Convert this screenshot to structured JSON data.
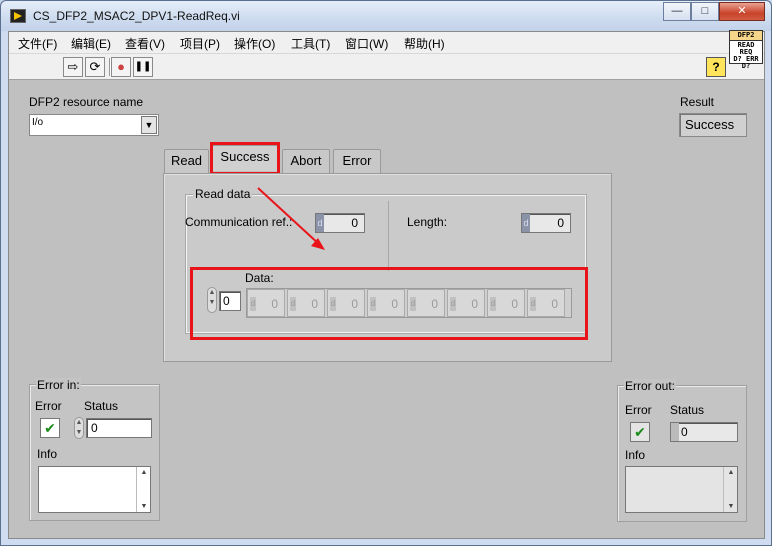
{
  "window": {
    "title": "CS_DFP2_MSAC2_DPV1-ReadReq.vi",
    "min_glyph": "—",
    "max_glyph": "□",
    "close_glyph": "✕"
  },
  "menu": [
    "文件(F)",
    "编辑(E)",
    "查看(V)",
    "项目(P)",
    "操作(O)",
    "工具(T)",
    "窗口(W)",
    "帮助(H)"
  ],
  "toolbar": {
    "run": "⇨",
    "run_continuous": "⟳",
    "abort": "●",
    "pause": "❚❚",
    "help": "?"
  },
  "vi_icon": {
    "line1": "DFP2",
    "line2": "READ",
    "line3": "REQ",
    "line4": "D? ERR D?"
  },
  "resource": {
    "label": "DFP2 resource name",
    "prefix": "I/o",
    "value": ""
  },
  "result": {
    "label": "Result",
    "value": "Success"
  },
  "tabs": [
    {
      "label": "Read",
      "active": false
    },
    {
      "label": "Success",
      "active": true
    },
    {
      "label": "Abort",
      "active": false
    },
    {
      "label": "Error",
      "active": false
    }
  ],
  "read_data": {
    "title": "Read data",
    "comm_ref_label": "Communication ref.:",
    "comm_ref_value": "0",
    "length_label": "Length:",
    "length_value": "0",
    "data_label": "Data:",
    "data_index": "0",
    "data_values": [
      "0",
      "0",
      "0",
      "0",
      "0",
      "0",
      "0",
      "0"
    ],
    "radix": "d"
  },
  "error_in": {
    "title": "Error in:",
    "error_label": "Error",
    "status_label": "Status",
    "status_value": "0",
    "info_label": "Info",
    "check": "✔"
  },
  "error_out": {
    "title": "Error out:",
    "error_label": "Error",
    "status_label": "Status",
    "status_value": "0",
    "info_label": "Info",
    "check": "✔"
  },
  "colors": {
    "highlight": "#e8141a",
    "panel": "#c0c0c0"
  }
}
